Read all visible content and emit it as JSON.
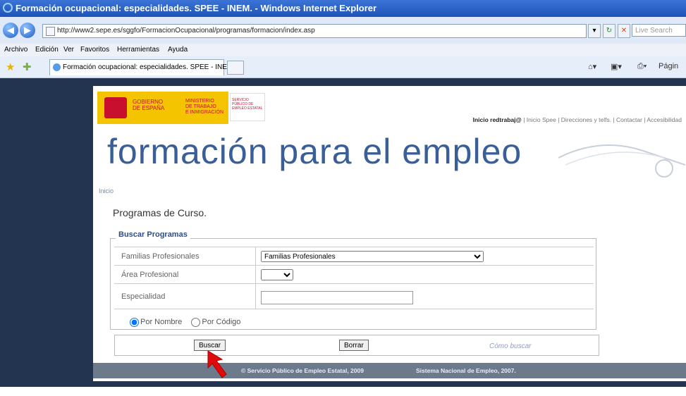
{
  "window": {
    "title": "Formación ocupacional: especialidades. SPEE - INEM. - Windows Internet Explorer"
  },
  "address": {
    "url": "http://www2.sepe.es/sggfo/FormacionOcupacional/programas/formacion/index.asp",
    "search_placeholder": "Live Search"
  },
  "menu": [
    "Archivo",
    "Edición",
    "Ver",
    "Favoritos",
    "Herramientas",
    "Ayuda"
  ],
  "tab": {
    "title": "Formación ocupacional: especialidades. SPEE - INEM."
  },
  "toolbar": {
    "page_label": "Págin"
  },
  "site": {
    "logo_gob": "GOBIERNO\nDE ESPAÑA",
    "logo_min": "MINISTERIO\nDE TRABAJO\nE INMIGRACIÓN",
    "logo_serv": "SERVICIO PÚBLICO DE EMPLEO ESTATAL",
    "links": [
      "Inicio redtrabaj@",
      "Inicio Spee",
      "Direcciones y telfs.",
      "Contactar",
      "Accesibilidad"
    ],
    "banner": "formación para el empleo",
    "breadcrumb": "Inicio",
    "heading": "Programas de Curso."
  },
  "form": {
    "legend": "Buscar Programas",
    "families_label": "Familias Profesionales",
    "families_value": "Familias Profesionales",
    "area_label": "Área Profesional",
    "area_value": "",
    "specialty_label": "Especialidad",
    "specialty_value": "",
    "radio_name": "Por Nombre",
    "radio_code": "Por Código",
    "search_button": "Buscar",
    "clear_button": "Borrar",
    "help_link": "Cómo buscar"
  },
  "footer": {
    "left": "© Servicio Público de Empleo Estatal, 2009",
    "right": "Sistema Nacional de Empleo, 2007."
  },
  "colors": {
    "titlebar": "#2a63c8",
    "page_bg": "#22344f",
    "banner_text": "#3a5f98",
    "legend_text": "#2b4d8c",
    "footer_bg": "#6d7a8c",
    "arrow": "#e10b0b"
  }
}
